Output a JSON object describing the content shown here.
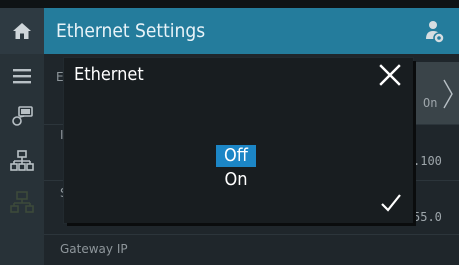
{
  "header": {
    "title": "Ethernet Settings",
    "accent_color": "#247c9c",
    "icons": [
      "home-icon",
      "user-settings-icon"
    ]
  },
  "sidebar": {
    "icons": [
      "menu-icon",
      "devices-icon",
      "network-icon",
      "network-disabled-icon"
    ]
  },
  "background": {
    "row1_label_fragment": "E",
    "row1_value": "On",
    "row2_label_fragment": "I",
    "row2_value_fragment": ".100",
    "row3_label_fragment": "S",
    "row3_value_fragment": "55.0",
    "row4_label": "Gateway IP"
  },
  "dialog": {
    "title": "Ethernet",
    "options": [
      "Off",
      "On"
    ],
    "selected": "Off",
    "selection_color": "#1c86c6"
  }
}
